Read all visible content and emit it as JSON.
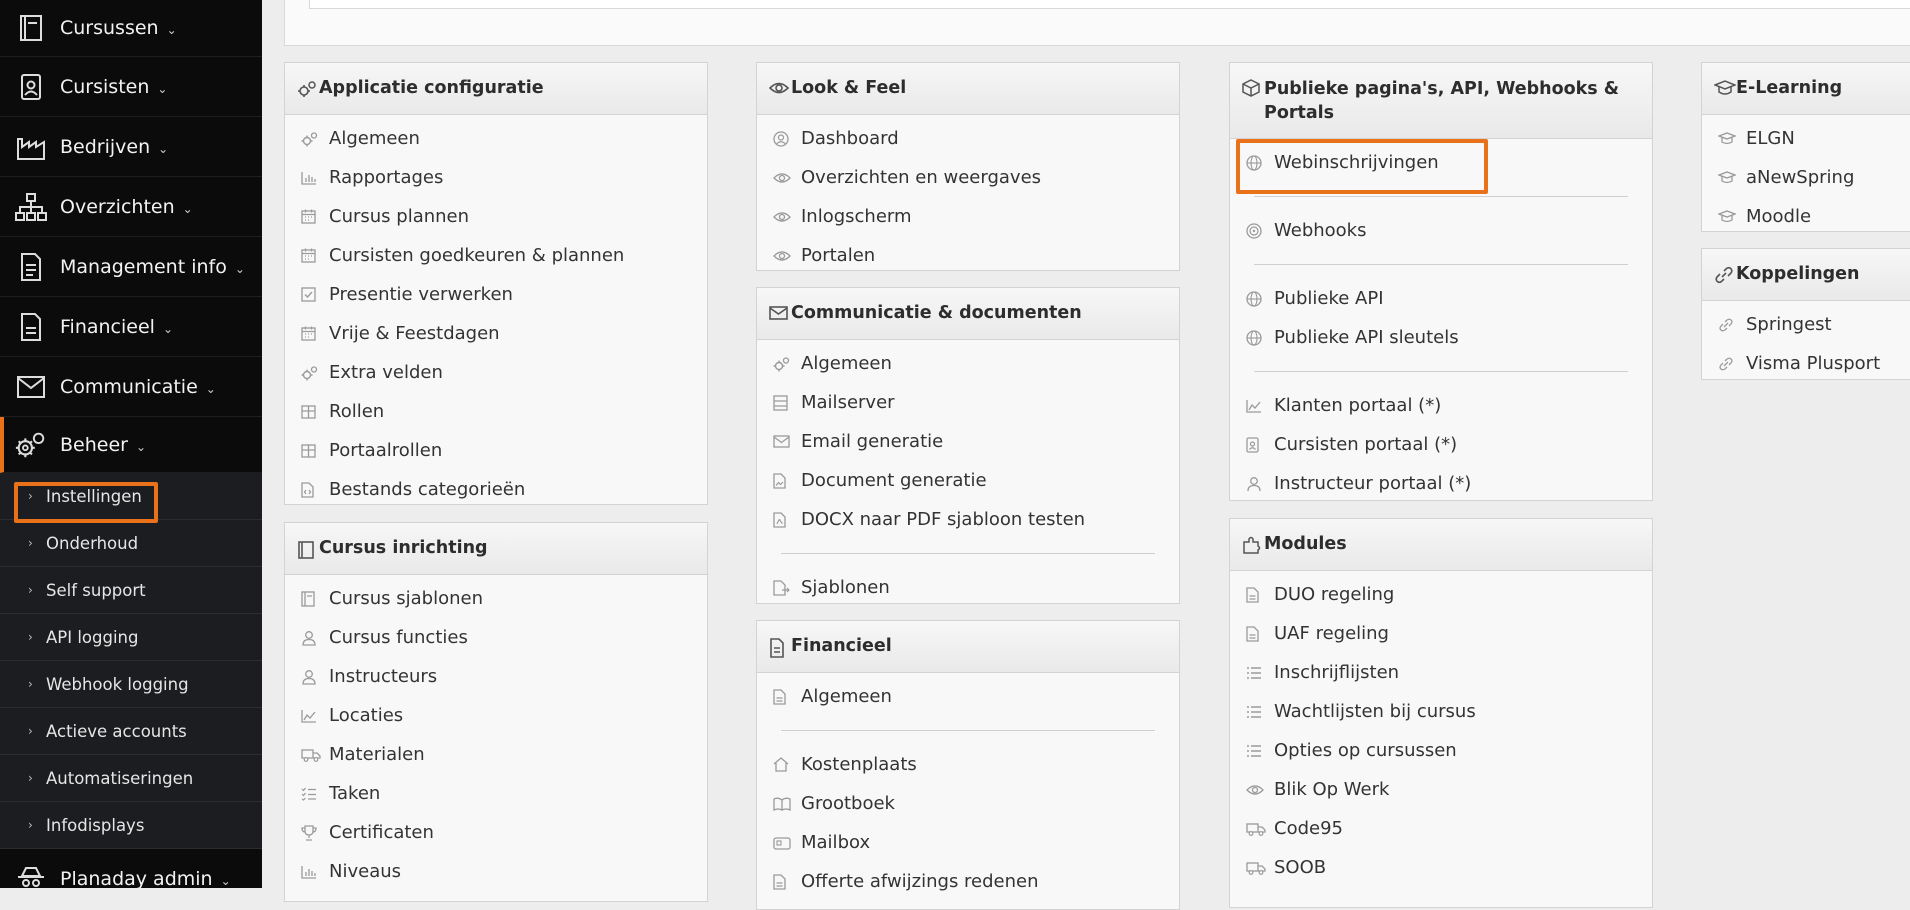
{
  "sidebar": {
    "menu": [
      {
        "label": "Cursussen",
        "icon": "book-icon"
      },
      {
        "label": "Cursisten",
        "icon": "id-badge-icon"
      },
      {
        "label": "Bedrijven",
        "icon": "factory-icon"
      },
      {
        "label": "Overzichten",
        "icon": "sitemap-icon"
      },
      {
        "label": "Management info",
        "icon": "document-icon"
      },
      {
        "label": "Financieel",
        "icon": "file-icon"
      },
      {
        "label": "Communicatie",
        "icon": "envelope-icon"
      },
      {
        "label": "Beheer",
        "icon": "cogs-icon"
      }
    ],
    "submenu": [
      "Instellingen",
      "Onderhoud",
      "Self support",
      "API logging",
      "Webhook logging",
      "Actieve accounts",
      "Automatiseringen",
      "Infodisplays"
    ],
    "bottom": {
      "label": "Planaday admin",
      "icon": "spy-icon"
    },
    "highlight_color": "#e8711a"
  },
  "panels": {
    "app_config": {
      "title": "Applicatie configuratie",
      "items": [
        "Algemeen",
        "Rapportages",
        "Cursus plannen",
        "Cursisten goedkeuren & plannen",
        "Presentie verwerken",
        "Vrije & Feestdagen",
        "Extra velden",
        "Rollen",
        "Portaalrollen",
        "Bestands categorieën"
      ]
    },
    "course_setup": {
      "title": "Cursus inrichting",
      "items": [
        "Cursus sjablonen",
        "Cursus functies",
        "Instructeurs",
        "Locaties",
        "Materialen",
        "Taken",
        "Certificaten",
        "Niveaus"
      ]
    },
    "look_feel": {
      "title": "Look & Feel",
      "items": [
        "Dashboard",
        "Overzichten en weergaves",
        "Inlogscherm",
        "Portalen"
      ]
    },
    "communication": {
      "title": "Communicatie & documenten",
      "items": [
        "Algemeen",
        "Mailserver",
        "Email generatie",
        "Document generatie",
        "DOCX naar PDF sjabloon testen"
      ],
      "items2": [
        "Sjablonen"
      ]
    },
    "financial": {
      "title": "Financieel",
      "items": [
        "Algemeen"
      ],
      "items2": [
        "Kostenplaats",
        "Grootboek",
        "Mailbox",
        "Offerte afwijzings redenen"
      ]
    },
    "public": {
      "title": "Publieke pagina's, API, Webhooks & Portals",
      "group1": [
        "Webinschrijvingen"
      ],
      "group2": [
        "Webhooks"
      ],
      "group3": [
        "Publieke API",
        "Publieke API sleutels"
      ],
      "group4": [
        "Klanten portaal (*)",
        "Cursisten portaal (*)",
        "Instructeur portaal (*)"
      ]
    },
    "modules": {
      "title": "Modules",
      "items": [
        "DUO regeling",
        "UAF regeling",
        "Inschrijflijsten",
        "Wachtlijsten bij cursus",
        "Opties op cursussen",
        "Blik Op Werk",
        "Code95",
        "SOOB"
      ]
    },
    "elearning": {
      "title": "E-Learning",
      "items": [
        "ELGN",
        "aNewSpring",
        "Moodle"
      ]
    },
    "connections": {
      "title": "Koppelingen",
      "items": [
        "Springest",
        "Visma Plusport"
      ]
    }
  }
}
